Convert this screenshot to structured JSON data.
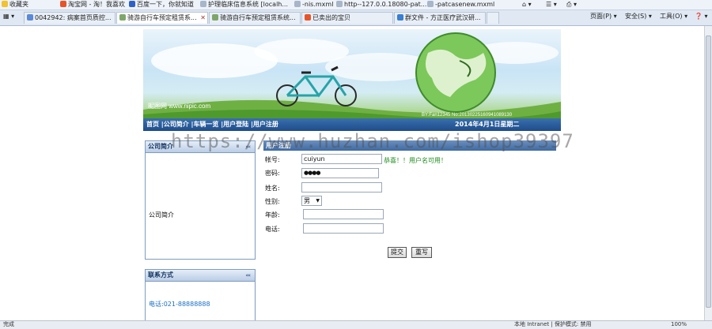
{
  "favorites": {
    "star_label": "收藏夹",
    "items": [
      "淘宝网 - 淘！我喜欢",
      "百度一下，你就知道",
      "护理临床信息系统 [localh...",
      "-nis.mxml",
      "http--127.0.0.18080-pat...",
      "-patcasenew.mxml"
    ]
  },
  "tabs": [
    {
      "label": "0042942: 病案首页质控..."
    },
    {
      "label": "骑游自行车预定租赁系..."
    },
    {
      "label": "骑游自行车预定租赁系统..."
    },
    {
      "label": "已卖出的宝贝"
    },
    {
      "label": "群文件 - 方正医疗武汉研..."
    }
  ],
  "toolbar": {
    "page": "页面(P) ▾",
    "safety": "安全(S) ▾",
    "tools": "工具(O) ▾",
    "help": "❓ ▾"
  },
  "banner": {
    "logo_text": "昵图网 www.nipic.com",
    "credit": "BY:Fan12345  No:20130225160941089130"
  },
  "nav": {
    "items": [
      "首页",
      "公司简介",
      "车辆一览",
      "用户登陆",
      "用户注册"
    ],
    "date": "2014年4月1日星期二"
  },
  "sidebar": {
    "intro_title": "公司简介",
    "intro_body": "公司简介",
    "contact_title": "联系方式",
    "phone": "电话:021-88888888",
    "arrows": "‹‹‹"
  },
  "form": {
    "title": "用户注册",
    "account_label": "帐号:",
    "account_value": "cuiyun",
    "account_hint": "恭喜！！用户名可用！",
    "password_label": "密码:",
    "password_value": "●●●●",
    "name_label": "姓名:",
    "gender_label": "性别:",
    "gender_value": "男",
    "age_label": "年龄:",
    "phone_label": "电话:",
    "submit": "提交",
    "reset": "重写"
  },
  "status": {
    "left": "完成",
    "zone": "本地 Intranet | 保护模式: 禁用",
    "zoom": "100%"
  },
  "watermark": "https://www.huzhan.com/ishop39397"
}
